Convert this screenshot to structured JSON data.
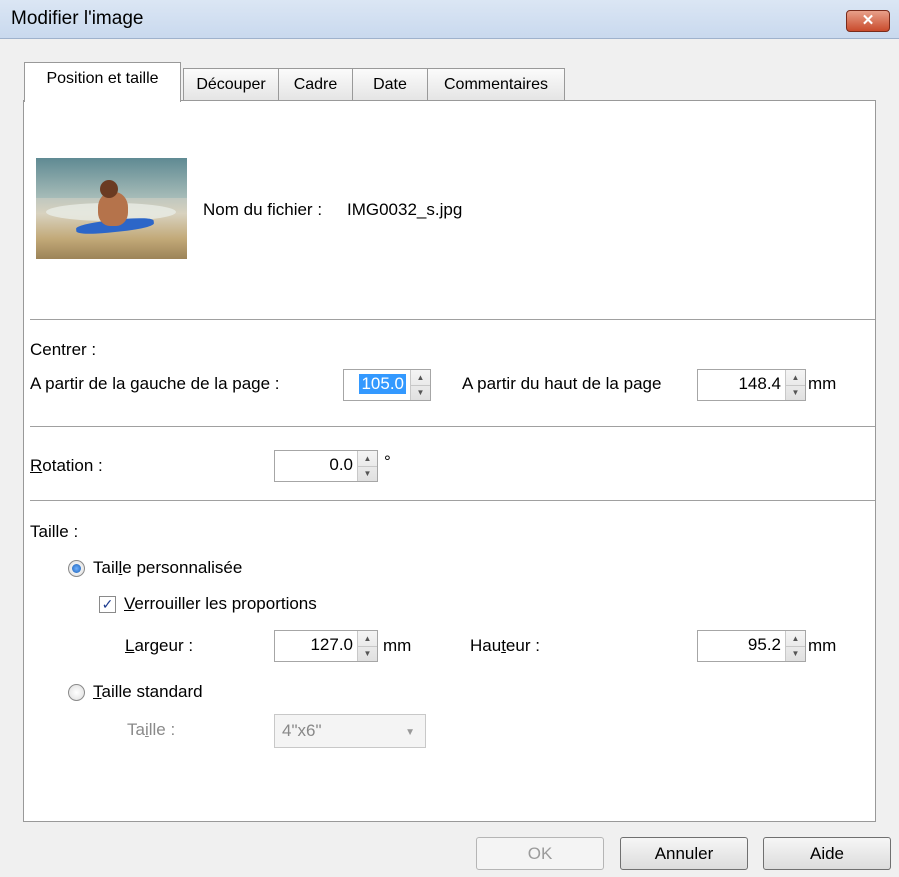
{
  "window": {
    "title": "Modifier l'image",
    "close_glyph": "✕"
  },
  "tabs": [
    {
      "label": "Position et taille",
      "active": true
    },
    {
      "label": "Découper",
      "active": false
    },
    {
      "label": "Cadre",
      "active": false
    },
    {
      "label": "Date",
      "active": false
    },
    {
      "label": "Commentaires",
      "active": false
    }
  ],
  "file": {
    "label": "Nom du fichier :",
    "name": "IMG0032_s.jpg"
  },
  "center": {
    "heading": "Centrer :",
    "left_label": "A partir de la gauche de la page :",
    "left_value": "105.0",
    "top_label": "A partir du haut de la page",
    "top_value": "148.4",
    "unit": "mm"
  },
  "rotation": {
    "label": "Rotation :",
    "value": "0.0",
    "unit": "°"
  },
  "size": {
    "heading": "Taille :",
    "custom_label": "Taille personnalisée",
    "custom_selected": true,
    "lock_label": "Verrouiller les proportions",
    "lock_checked": true,
    "width_label": "Largeur :",
    "width_value": "127.0",
    "height_label": "Hauteur :",
    "height_value": "95.2",
    "unit": "mm",
    "standard_label": "Taille standard",
    "standard_selected": false,
    "std_size_label": "Taille :",
    "std_size_value": "4\"x6\""
  },
  "buttons": {
    "ok": "OK",
    "cancel": "Annuler",
    "help": "Aide"
  },
  "icons": {
    "spin_up": "▲",
    "spin_down": "▼",
    "combo_arrow": "▼",
    "check": "✓"
  },
  "thumbnail": {
    "description_icon": "photo-thumbnail"
  }
}
